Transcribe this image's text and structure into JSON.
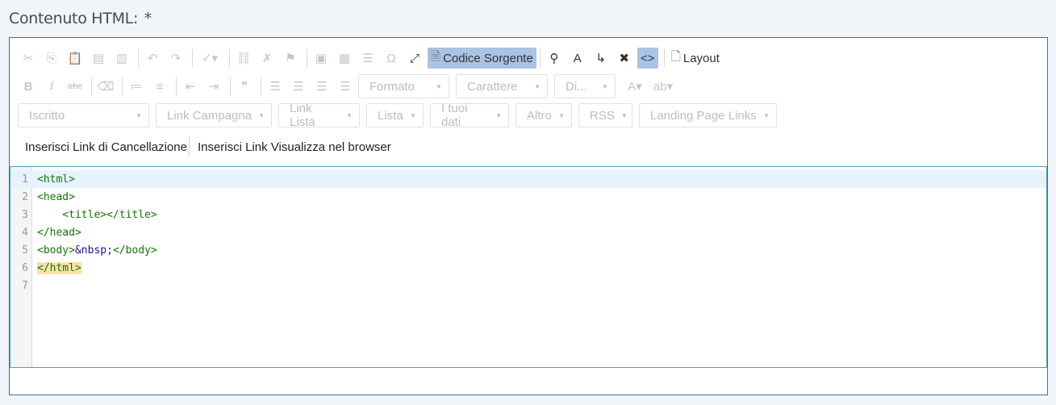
{
  "field": {
    "label": "Contenuto HTML:",
    "required_mark": "*"
  },
  "toolbar": {
    "row1": {
      "icons": [
        "cut-icon",
        "copy-icon",
        "paste-icon",
        "paste-text-icon",
        "paste-word-icon",
        "undo-icon",
        "redo-icon",
        "spellcheck-icon",
        "link-icon",
        "unlink-icon",
        "anchor-icon",
        "image-icon",
        "table-icon",
        "horizontal-rule-icon",
        "special-char-icon",
        "maximize-icon"
      ],
      "source_label": "Codice Sorgente",
      "layout_label": "Layout"
    },
    "row2": {
      "icons": [
        "bold-icon",
        "italic-icon",
        "strikethrough-icon",
        "remove-format-icon",
        "numbered-list-icon",
        "bulleted-list-icon",
        "outdent-icon",
        "indent-icon",
        "blockquote-icon",
        "align-left-icon",
        "align-center-icon",
        "align-right-icon",
        "align-justify-icon"
      ],
      "format_label": "Formato",
      "font_label": "Carattere",
      "size_label": "Di..."
    },
    "row3": {
      "combos": [
        "Iscritto",
        "Link Campagna",
        "Link Lista",
        "Lista",
        "I tuoi dati",
        "Altro",
        "RSS",
        "Landing Page Links"
      ]
    },
    "row4": {
      "unsubscribe_link": "Inserisci Link di Cancellazione",
      "browser_link": "Inserisci Link Visualizza nel browser"
    }
  },
  "code_lines": [
    {
      "num": "1",
      "text": "<html>"
    },
    {
      "num": "2",
      "text": "<head>"
    },
    {
      "num": "3",
      "text": "    <title></title>"
    },
    {
      "num": "4",
      "text": "</head>"
    },
    {
      "num": "5",
      "text": "<body>",
      "entity": "&nbsp;",
      "tail": "</body>"
    },
    {
      "num": "6",
      "text": "</html>"
    },
    {
      "num": "7",
      "text": ""
    }
  ],
  "colors": {
    "accent": "#a9c3e4",
    "border": "#3a6f9e",
    "code_tag": "#117700",
    "code_entity": "#221199"
  }
}
